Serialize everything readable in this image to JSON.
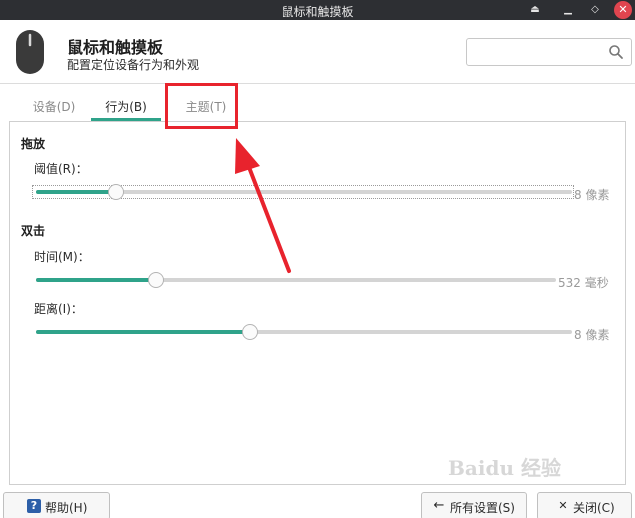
{
  "window": {
    "title": "鼠标和触摸板"
  },
  "header": {
    "title": "鼠标和触摸板",
    "subtitle": "配置定位设备行为和外观",
    "icon": "mouse-icon",
    "search_placeholder": ""
  },
  "tabs": [
    {
      "label": "设备(D)",
      "active": false
    },
    {
      "label": "行为(B)",
      "active": true
    },
    {
      "label": "主题(T)",
      "active": false
    }
  ],
  "drag": {
    "title": "拖放",
    "threshold": {
      "label": "阈值(R)：",
      "value": "8 像素",
      "fraction": 0.15
    }
  },
  "double_click": {
    "title": "双击",
    "time": {
      "label": "时间(M)：",
      "value": "532 毫秒",
      "fraction": 0.23
    },
    "distance": {
      "label": "距离(I)：",
      "value": "8 像素",
      "fraction": 0.4
    }
  },
  "buttons": {
    "help": "帮助(H)",
    "all_settings": "所有设置(S)",
    "close": "关闭(C)"
  },
  "watermark": "Baidu 经验",
  "colors": {
    "accent": "#2fa38a",
    "highlight": "#e8232d",
    "titlebar": "#2d2f33"
  }
}
